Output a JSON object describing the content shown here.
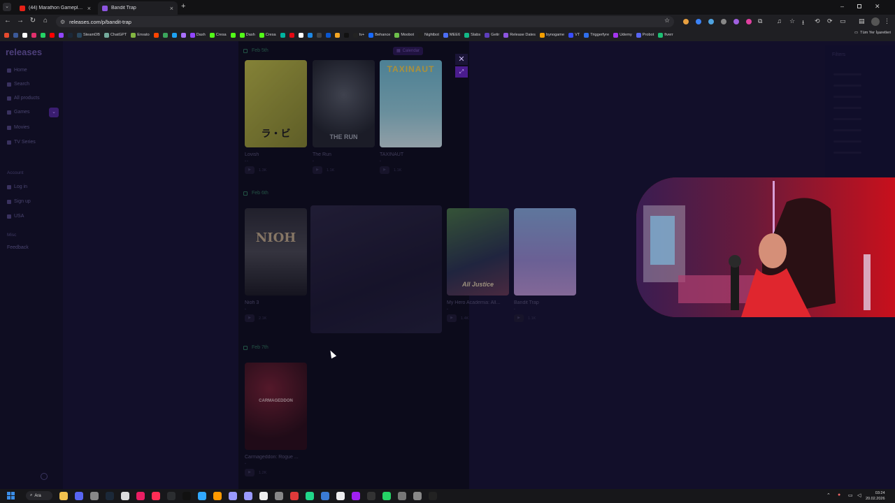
{
  "browser": {
    "tabs": [
      {
        "label": "(44) Marathon Gameplay and I",
        "favicon_color": "#e62117",
        "active": false
      },
      {
        "label": "Bandit Trap",
        "favicon_color": "#8d55e0",
        "active": true
      }
    ],
    "url": "releases.com/p/bandit-trap",
    "bookmarks": [
      {
        "label": "",
        "color": "#e64a2e"
      },
      {
        "label": "",
        "color": "#3b5998"
      },
      {
        "label": "",
        "color": "#ffffff"
      },
      {
        "label": "",
        "color": "#e1306c"
      },
      {
        "label": "",
        "color": "#25d366"
      },
      {
        "label": "",
        "color": "#ff0000"
      },
      {
        "label": "",
        "color": "#9146ff"
      },
      {
        "label": "",
        "color": "#1b2838"
      },
      {
        "label": "SteamDB",
        "color": "#2a475e"
      },
      {
        "label": "ChatGPT",
        "color": "#74aa9c"
      },
      {
        "label": "Envato",
        "color": "#82b541"
      },
      {
        "label": "",
        "color": "#ff4500"
      },
      {
        "label": "",
        "color": "#3ba55c"
      },
      {
        "label": "",
        "color": "#1da1f2"
      },
      {
        "label": "",
        "color": "#a970ff"
      },
      {
        "label": "Dash",
        "color": "#9146ff"
      },
      {
        "label": "Cresa",
        "color": "#53fc18"
      },
      {
        "label": "",
        "color": "#53fc18"
      },
      {
        "label": "Dash",
        "color": "#53fc18"
      },
      {
        "label": "Cresa",
        "color": "#53fc18"
      },
      {
        "label": "",
        "color": "#00b4a0"
      },
      {
        "label": "",
        "color": "#e50914"
      },
      {
        "label": "",
        "color": "#ffffff"
      },
      {
        "label": "",
        "color": "#1e88e5"
      },
      {
        "label": "",
        "color": "#444444"
      },
      {
        "label": "",
        "color": "#0b57d0"
      },
      {
        "label": "",
        "color": "#f5a623"
      },
      {
        "label": "",
        "color": "#111111"
      },
      {
        "label": "tv+",
        "color": "#222222"
      },
      {
        "label": "Behance",
        "color": "#1769ff"
      },
      {
        "label": "Moobot",
        "color": "#6dbf4b"
      },
      {
        "label": "Nightbot",
        "color": "#1f1f1f"
      },
      {
        "label": "MEE6",
        "color": "#4c6ef5"
      },
      {
        "label": "Slabs",
        "color": "#12b886"
      },
      {
        "label": "Getir",
        "color": "#5d3ebc"
      },
      {
        "label": "Release Dates",
        "color": "#8d55e0"
      },
      {
        "label": "bynogame",
        "color": "#f59f00"
      },
      {
        "label": "VT",
        "color": "#394eff"
      },
      {
        "label": "Triggerfyre",
        "color": "#2f6fed"
      },
      {
        "label": "Udemy",
        "color": "#a435f0"
      },
      {
        "label": "Probot",
        "color": "#5865f2"
      },
      {
        "label": "fiverr",
        "color": "#1dbf73"
      }
    ],
    "bookmarks_folder": "Tüm Yer İşaretleri"
  },
  "site": {
    "logo": "releases",
    "nav": [
      {
        "label": "Home"
      },
      {
        "label": "Search"
      },
      {
        "label": "All products"
      },
      {
        "label": "Games"
      },
      {
        "label": "Movies"
      },
      {
        "label": "TV Series"
      }
    ],
    "account_section": "Account",
    "account_items": [
      "Log in",
      "Sign up",
      "USA"
    ],
    "misc_section": "Misc",
    "misc_items": [
      "Feedback"
    ],
    "calendar_chip": "Calendar",
    "filter_title": "Filters"
  },
  "feed": {
    "sections": [
      {
        "date": "Feb 5th",
        "cards": [
          {
            "title": "Lovish",
            "count": "1.3K",
            "color_a": "#b8b83a",
            "color_b": "#6e6e20",
            "cover_text": ""
          },
          {
            "title": "The Run",
            "count": "1.1K",
            "color_a": "#3a3f45",
            "color_b": "#1d2126",
            "cover_text": "THE RUN"
          },
          {
            "title": "TAXINAUT",
            "count": "1.1K",
            "color_a": "#7fc6d8",
            "color_b": "#a6d9e2",
            "cover_text": "TAXINAUT"
          }
        ]
      },
      {
        "date": "Feb 6th",
        "cards": [
          {
            "title": "Nioh 3",
            "count": "2.1K",
            "color_a": "#3a3a42",
            "color_b": "#1b1b22",
            "cover_text": "NIOH"
          },
          {
            "title": "My Hero Academia: All...",
            "count": "1.4K",
            "color_a": "#3d5a3a",
            "color_b": "#2c2f48",
            "cover_text": "All Justice"
          },
          {
            "title": "Bandit Trap",
            "count": "1.1K",
            "color_a": "#7d9fd6",
            "color_b": "#a880c8",
            "cover_text": ""
          }
        ]
      },
      {
        "date": "Feb 7th",
        "cards": [
          {
            "title": "Carmageddon: Rogue ...",
            "count": "1.2K",
            "color_a": "#4a1a22",
            "color_b": "#1a0c10",
            "cover_text": "CARMAGEDDON"
          }
        ]
      }
    ]
  },
  "taskbar": {
    "search_label": "Ara",
    "time": "03:24",
    "date": "20.02.2026"
  }
}
